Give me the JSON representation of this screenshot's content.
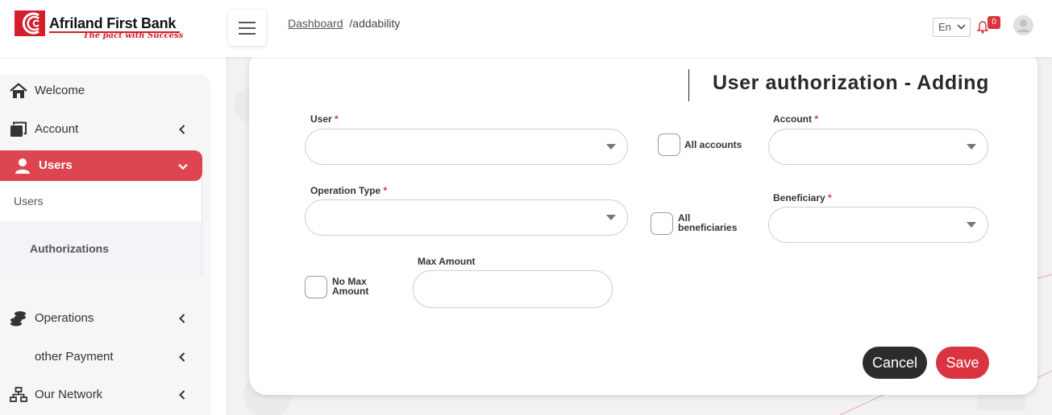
{
  "header": {
    "bank_name": "Afriland First Bank",
    "tagline": "The pact with Success",
    "breadcrumb_link": "Dashboard",
    "breadcrumb_current": "/addability",
    "language": "En",
    "notification_count": "0"
  },
  "sidebar": {
    "items": [
      {
        "label": "Welcome",
        "icon": "home-icon"
      },
      {
        "label": "Account",
        "icon": "wallet-icon"
      },
      {
        "label": "Users",
        "icon": "user-icon"
      },
      {
        "label": "Operations",
        "icon": "coins-icon"
      },
      {
        "label": "other Payment"
      },
      {
        "label": "Our Network",
        "icon": "network-icon"
      }
    ],
    "sub_items": {
      "users": "Users",
      "authorizations": "Authorizations"
    }
  },
  "form": {
    "title": "User authorization - Adding",
    "user_label": "User",
    "account_label": "Account",
    "all_accounts_label": "All accounts",
    "operation_type_label": "Operation Type",
    "beneficiary_label": "Beneficiary",
    "all_beneficiaries_line1": "All",
    "all_beneficiaries_line2": "beneficiaries",
    "no_max_line1": "No Max",
    "no_max_line2": "Amount",
    "max_amount_label": "Max Amount",
    "required_mark": "*",
    "cancel_label": "Cancel",
    "save_label": "Save"
  },
  "colors": {
    "accent": "#dd4551",
    "save": "#d9343f",
    "cancel": "#2c2c2c"
  }
}
